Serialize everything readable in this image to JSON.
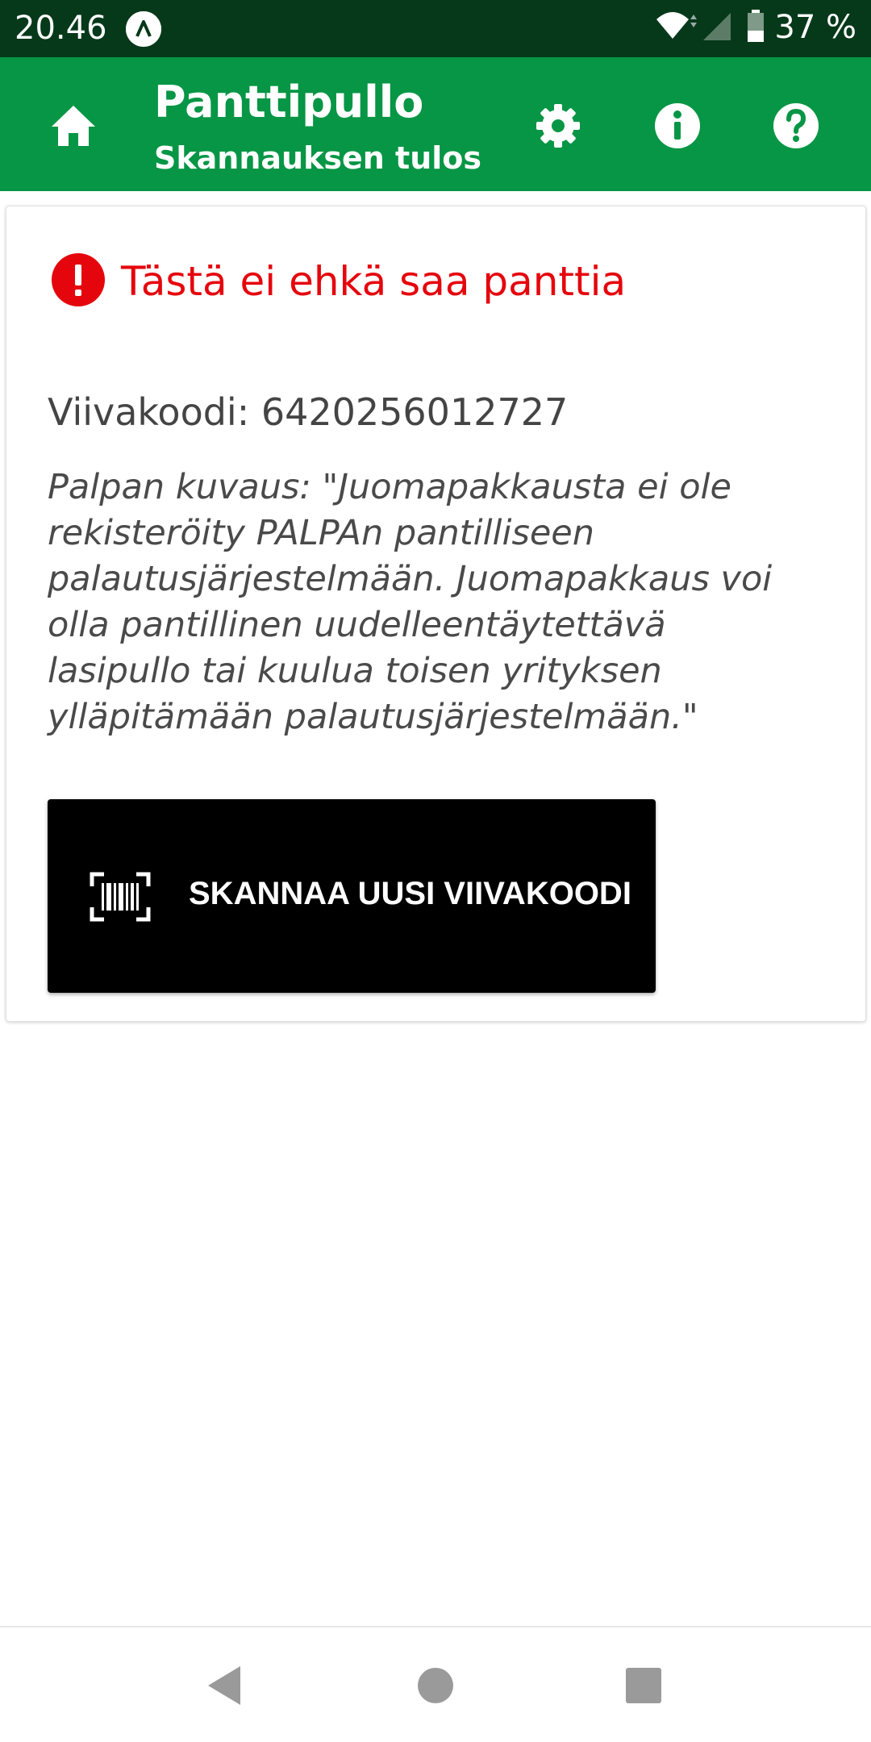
{
  "status_bar": {
    "time": "20.46",
    "battery": "37 %",
    "icons": [
      "app-notification-icon",
      "wifi-icon",
      "signal-icon",
      "battery-icon"
    ]
  },
  "app_bar": {
    "title": "Panttipullo",
    "subtitle": "Skannauksen tulos",
    "icons": [
      "home-icon",
      "gear-icon",
      "info-icon",
      "help-icon"
    ],
    "color": "#069645"
  },
  "result": {
    "warning_title": "Tästä ei ehkä saa panttia",
    "warning_color": "#e5060d",
    "barcode": "Viivakoodi: 6420256012727",
    "description": "Palpan kuvaus: \"Juomapakkausta ei ole rekisteröity PALPAn pantilliseen palautusjärjestelmään. Juomapakkaus voi olla pantillinen uudelleentäytettävä lasipullo tai kuulua toisen yrityksen ylläpitämään palautusjärjestelmään.\""
  },
  "scan_button": {
    "label": "SKANNAA UUSI VIIVAKOODI",
    "icon": "barcode-scan-icon"
  },
  "nav_bar": {
    "icons": [
      "back-icon",
      "home-circle-icon",
      "recents-icon"
    ]
  }
}
